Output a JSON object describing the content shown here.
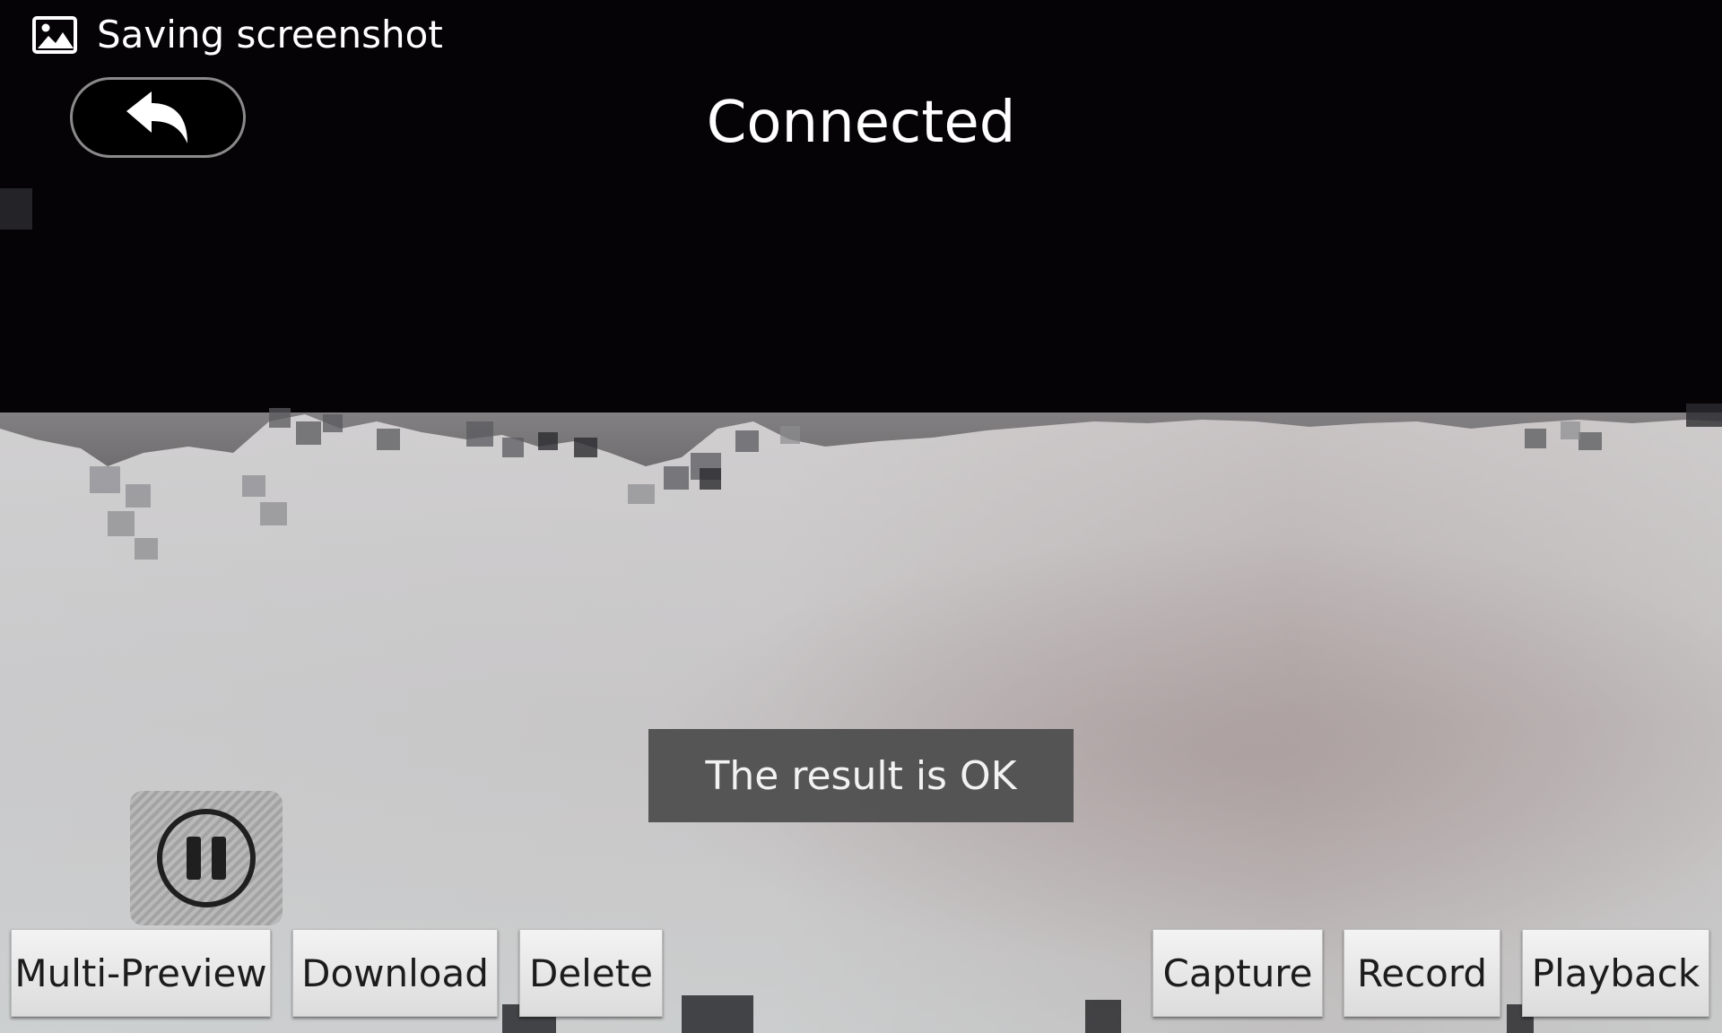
{
  "status_bar": {
    "notification_icon": "image-icon",
    "notification_text": "Saving screenshot"
  },
  "header": {
    "back_icon": "undo-arrow-icon",
    "connection_status": "Connected"
  },
  "toast": {
    "message": "The result is OK"
  },
  "controls": {
    "pause_icon": "pause-icon"
  },
  "bottom_bar": {
    "multi_preview": "Multi-Preview",
    "download": "Download",
    "delete": "Delete",
    "capture": "Capture",
    "record": "Record",
    "playback": "Playback"
  },
  "colors": {
    "background": "#060306",
    "button_face": "#ececec",
    "toast_bg": "#505050",
    "text_light": "#ffffff"
  }
}
